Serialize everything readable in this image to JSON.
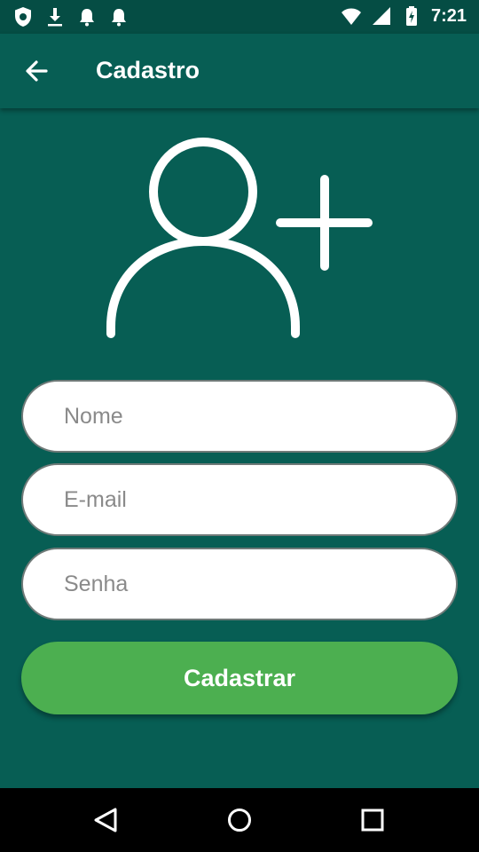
{
  "status_bar": {
    "time": "7:21",
    "left_icons": [
      "shield-icon",
      "download-icon",
      "notification-bell-icon",
      "notification-bell-icon"
    ],
    "right_icons": [
      "wifi-icon",
      "signal-icon",
      "battery-charging-icon"
    ]
  },
  "app_bar": {
    "title": "Cadastro",
    "back_icon": "arrow-back-icon"
  },
  "hero": {
    "icon": "add-user-icon"
  },
  "form": {
    "name_placeholder": "Nome",
    "email_placeholder": "E-mail",
    "password_placeholder": "Senha",
    "submit_label": "Cadastrar"
  },
  "nav_bar": {
    "icons": [
      "nav-back-icon",
      "nav-home-icon",
      "nav-recents-icon"
    ]
  },
  "colors": {
    "background": "#075e54",
    "status_bar": "#054d44",
    "button": "#4caf50",
    "field": "#ffffff"
  }
}
